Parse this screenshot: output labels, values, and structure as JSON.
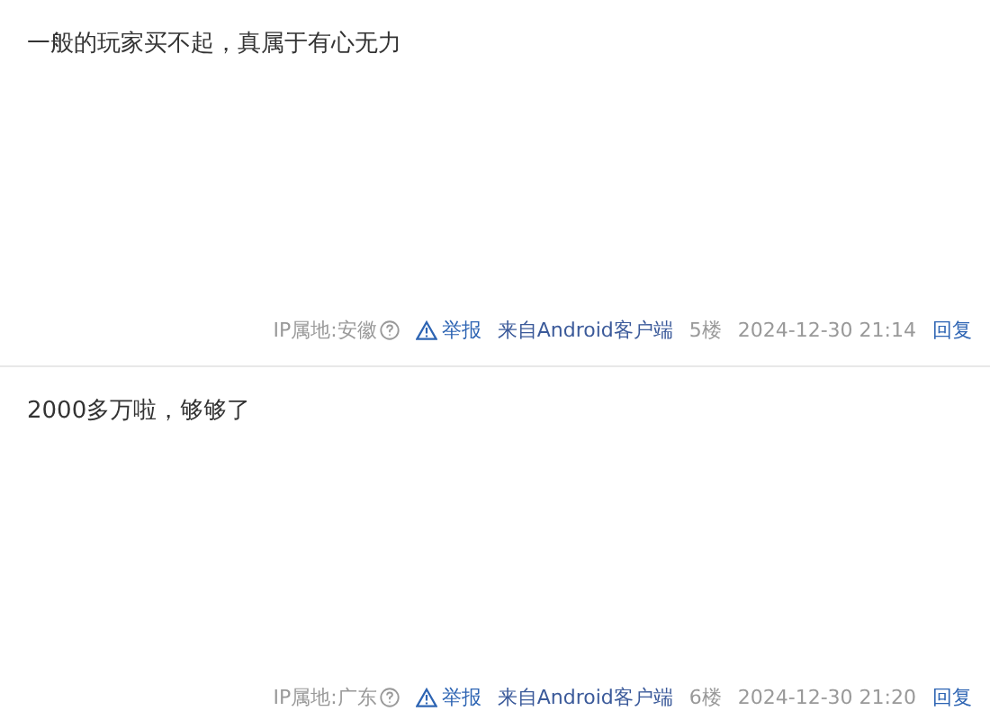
{
  "posts": [
    {
      "content": "一般的玩家买不起，真属于有心无力",
      "ip_location": "IP属地:安徽",
      "report": "举报",
      "source": "来自Android客户端",
      "floor": "5楼",
      "time": "2024-12-30 21:14",
      "reply": "回复"
    },
    {
      "content": "2000多万啦，够够了",
      "ip_location": "IP属地:广东",
      "report": "举报",
      "source": "来自Android客户端",
      "floor": "6楼",
      "time": "2024-12-30 21:20",
      "reply": "回复"
    }
  ]
}
